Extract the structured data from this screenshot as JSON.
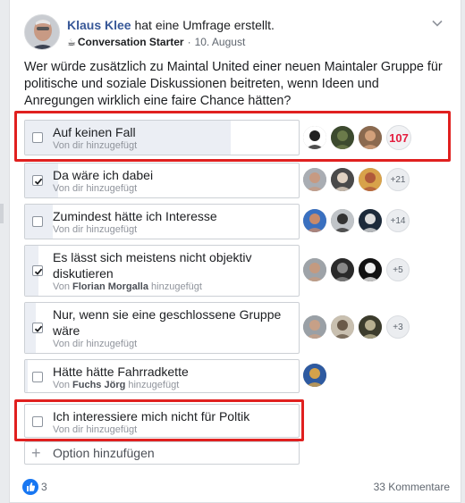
{
  "post": {
    "author": "Klaus Klee",
    "action": "hat eine Umfrage erstellt.",
    "badge": "Conversation Starter",
    "date": "10. August",
    "separator": "·",
    "question": "Wer würde zusätzlich zu Maintal United einer neuen Maintaler Gruppe für politische und soziale Diskussionen beitreten, wenn Ideen und Anregungen wirklich eine faire Chance hätten?"
  },
  "options": [
    {
      "label": "Auf keinen Fall",
      "sub_prefix": "Von dir",
      "sub_suffix": "hinzugefügt",
      "checked": false,
      "count": "107",
      "fill": 0.75
    },
    {
      "label": "Da wäre ich dabei",
      "sub_prefix": "Von dir",
      "sub_suffix": "hinzugefügt",
      "checked": true,
      "count": "+21",
      "fill": 0.12
    },
    {
      "label": "Zumindest hätte ich Interesse",
      "sub_prefix": "Von dir",
      "sub_suffix": "hinzugefügt",
      "checked": false,
      "count": "+14",
      "fill": 0.1
    },
    {
      "label": "Es lässt sich meistens nicht objektiv diskutieren",
      "sub_prefix": "Von",
      "sub_author": "Florian Morgalla",
      "sub_suffix": "hinzugefügt",
      "checked": true,
      "count": "+5",
      "fill": 0.05
    },
    {
      "label": "Nur, wenn sie eine geschlossene Gruppe wäre",
      "sub_prefix": "Von dir",
      "sub_suffix": "hinzugefügt",
      "checked": true,
      "count": "+3",
      "fill": 0.04
    },
    {
      "label": "Hätte hätte Fahrradkette",
      "sub_prefix": "Von",
      "sub_author": "Fuchs Jörg",
      "sub_suffix": "hinzugefügt",
      "checked": false,
      "count": "",
      "fill": 0.01
    },
    {
      "label": "Ich interessiere mich nicht für Poltik",
      "sub_prefix": "Von dir",
      "sub_suffix": "hinzugefügt",
      "checked": false,
      "count": "",
      "fill": 0
    }
  ],
  "add_option": {
    "plus": "+",
    "label": "Option hinzufügen"
  },
  "footer": {
    "likes": "3",
    "comments": "33 Kommentare"
  },
  "colors": {
    "link": "#385898",
    "like": "#1877f2",
    "highlight": "#e0201f",
    "hot_count": "#e41e3f"
  }
}
